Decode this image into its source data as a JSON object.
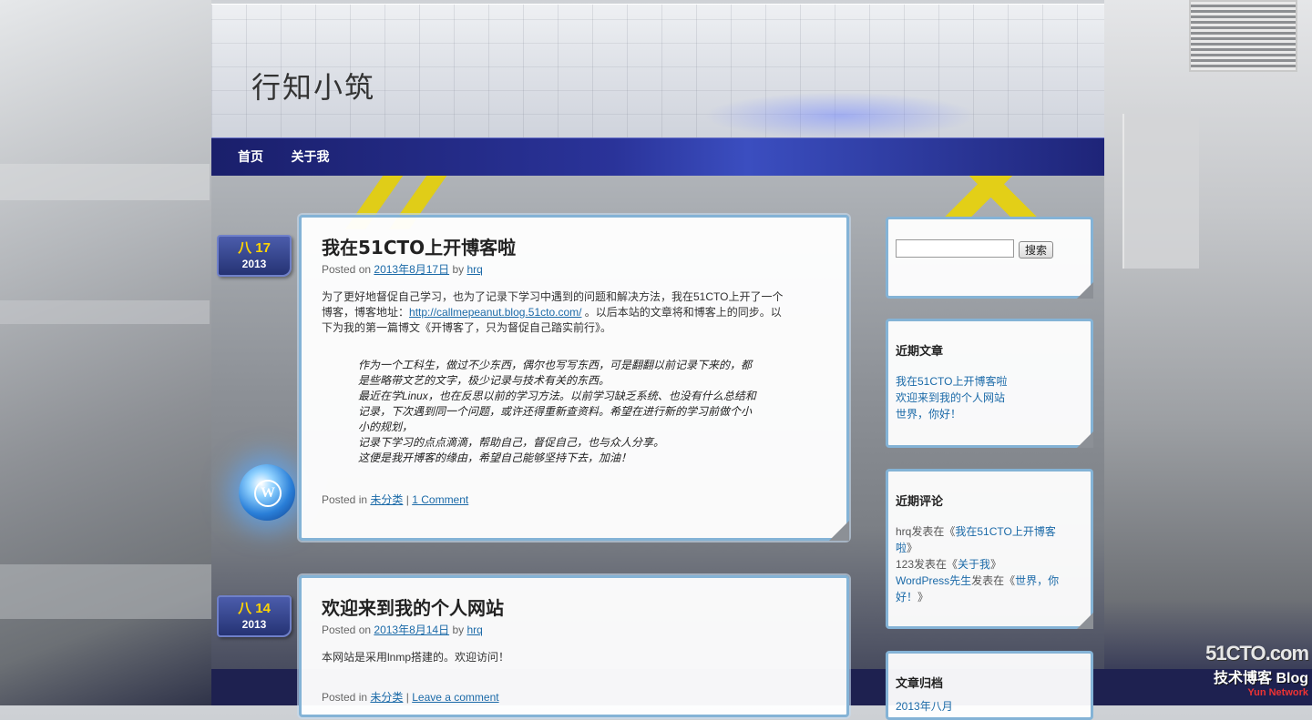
{
  "site": {
    "title": "行知小筑"
  },
  "nav": {
    "items": [
      {
        "label": "首页"
      },
      {
        "label": "关于我"
      }
    ]
  },
  "posts": [
    {
      "date": {
        "month": "八",
        "day": "17",
        "year": "2013"
      },
      "title": "我在51CTO上开博客啦",
      "meta": {
        "posted_on": "Posted on",
        "date": "2013年8月17日",
        "by": "by",
        "author": "hrq"
      },
      "body_line1": "为了更好地督促自己学习，也为了记录下学习中遇到的问题和解决方法，我在51CTO上开了一个",
      "body_line2_pre": "博客，博客地址：",
      "body_link": "http://callmepeanut.blog.51cto.com/",
      "body_line2_post": " 。以后本站的文章将和博客上的同步。以",
      "body_line3": "下为我的第一篇博文《开博客了，只为督促自己踏实前行》。",
      "quote": [
        "作为一个工科生，做过不少东西，偶尔也写写东西，可是翻翻以前记录下来的，都",
        "是些略带文艺的文字，极少记录与技术有关的东西。",
        "最近在学Linux，也在反思以前的学习方法。以前学习缺乏系统、也没有什么总结和",
        "记录，下次遇到同一个问题，或许还得重新查资料。希望在进行新的学习前做个小",
        "小的规划，",
        "记录下学习的点点滴滴，帮助自己，督促自己，也与众人分享。",
        "这便是我开博客的缘由，希望自己能够坚持下去，加油！"
      ],
      "footer": {
        "posted_in": "Posted in",
        "category": "未分类",
        "sep": "|",
        "comments": "1 Comment"
      }
    },
    {
      "date": {
        "month": "八",
        "day": "14",
        "year": "2013"
      },
      "title": "欢迎来到我的个人网站",
      "meta": {
        "posted_on": "Posted on",
        "date": "2013年8月14日",
        "by": "by",
        "author": "hrq"
      },
      "body": "本网站是采用lnmp搭建的。欢迎访问！",
      "footer": {
        "posted_in": "Posted in",
        "category": "未分类",
        "sep": "|",
        "comments": "Leave a comment"
      }
    }
  ],
  "sidebar": {
    "search": {
      "value": "",
      "button_label": "搜索"
    },
    "recent_posts": {
      "title": "近期文章",
      "items": [
        "我在51CTO上开博客啦",
        "欢迎来到我的个人网站",
        "世界，你好！"
      ]
    },
    "recent_comments": {
      "title": "近期评论",
      "items": [
        {
          "author": "hrq",
          "text": "发表在《",
          "post_a": "我在51CTO上开博客",
          "post_b": "啦",
          "close": "》"
        },
        {
          "author": "123",
          "text": "发表在《",
          "post": "关于我",
          "close": "》"
        },
        {
          "author": "WordPress先生",
          "text": "发表在《",
          "post_a": "世界，你",
          "post_b": "好！",
          "close": "》"
        }
      ]
    },
    "archives": {
      "title": "文章归档",
      "items": [
        "2013年八月"
      ]
    }
  },
  "watermark": {
    "line1": "51CTO.com",
    "line2": "技术博客 Blog",
    "line3": "Yun Network"
  },
  "colors": {
    "link": "#1b6aa8",
    "nav_bg": "#2a3399",
    "card_border": "#84b3d6",
    "date_highlight": "#ffd400"
  }
}
